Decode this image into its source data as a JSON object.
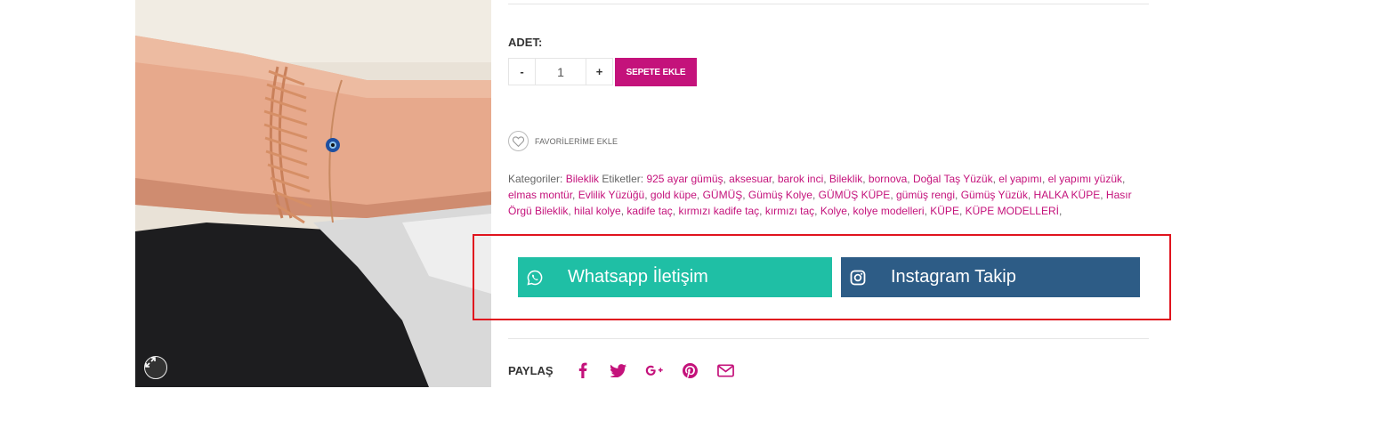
{
  "colors": {
    "accent": "#c4127b",
    "whatsapp": "#1fbfa5",
    "instagram": "#2d5c86",
    "highlight": "#e0141e"
  },
  "product": {
    "image_alt": "bracelet-on-wrist-photo",
    "zoom_icon": "expand-icon"
  },
  "quantity": {
    "label": "ADET:",
    "minus": "-",
    "value": "1",
    "plus": "+"
  },
  "cart": {
    "add_label": "SEPETE EKLE"
  },
  "favorites": {
    "icon": "heart-icon",
    "label": "FAVORİLERİME EKLE"
  },
  "meta": {
    "categories_label": "Kategoriler:",
    "categories": [
      "Bileklik"
    ],
    "tags_label": "Etiketler:",
    "tags": [
      "925 ayar gümüş",
      "aksesuar",
      "barok inci",
      "Bileklik",
      "bornova",
      "Doğal Taş Yüzük",
      "el yapımı",
      "el yapımı yüzük",
      "elmas montür",
      "Evlilik Yüzüğü",
      "gold küpe",
      "GÜMÜŞ",
      "Gümüş Kolye",
      "GÜMÜŞ KÜPE",
      "gümüş rengi",
      "Gümüş Yüzük",
      "HALKA KÜPE",
      "Hasır Örgü Bileklik",
      "hilal kolye",
      "kadife taç",
      "kırmızı kadife taç",
      "kırmızı taç",
      "Kolye",
      "kolye modelleri",
      "KÜPE",
      "KÜPE MODELLERİ"
    ]
  },
  "social": {
    "whatsapp_label": "Whatsapp İletişim",
    "whatsapp_icon": "whatsapp-icon",
    "instagram_label": "Instagram Takip",
    "instagram_icon": "instagram-icon"
  },
  "share": {
    "label": "PAYLAŞ",
    "icons": [
      "facebook-icon",
      "twitter-icon",
      "google-plus-icon",
      "pinterest-icon",
      "email-icon"
    ]
  }
}
